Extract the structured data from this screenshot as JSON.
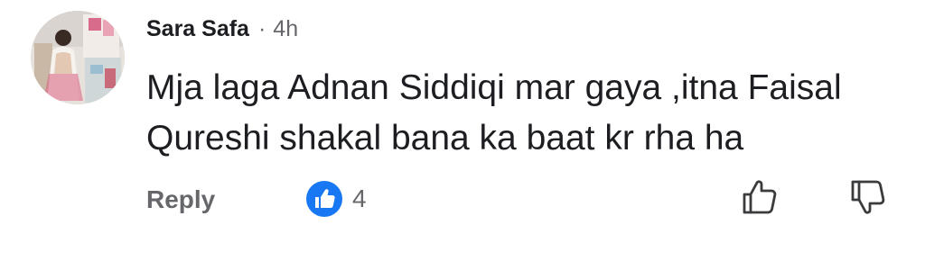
{
  "comment": {
    "author": "Sara Safa",
    "separator": "·",
    "time": "4h",
    "text": "Mja laga Adnan Siddiqi mar gaya ,itna Faisal Qureshi shakal bana ka baat kr rha ha",
    "avatar_icon": "profile-photo"
  },
  "actions": {
    "reply_label": "Reply",
    "reaction_icon": "like-reaction-icon",
    "reaction_count": "4",
    "upvote_icon": "thumbs-up-icon",
    "downvote_icon": "thumbs-down-icon"
  },
  "colors": {
    "text": "#1c1e21",
    "secondary": "#65676b",
    "like_blue": "#1877f2"
  }
}
